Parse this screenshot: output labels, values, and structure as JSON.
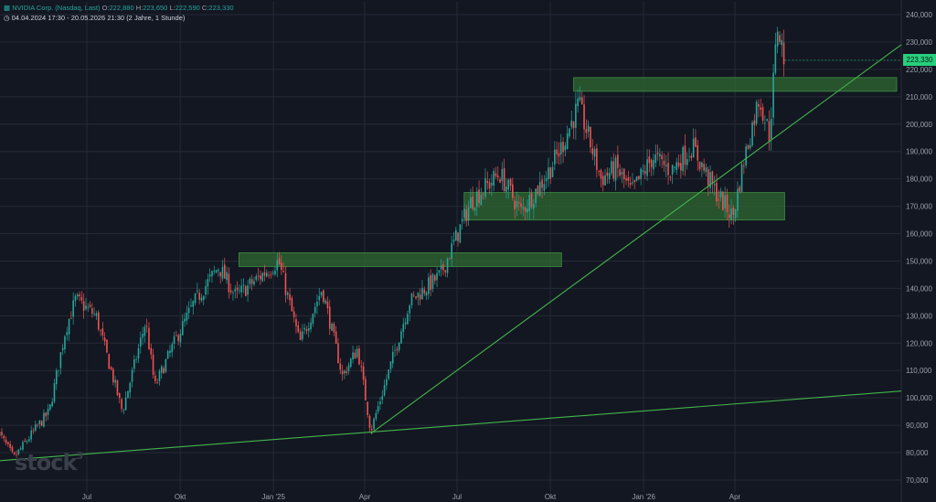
{
  "header": {
    "symbol": "NVIDIA Corp. (Nasdaq, Last)",
    "open_label": "O:",
    "open": "222,880",
    "high_label": "H:",
    "high": "223,650",
    "low_label": "L:",
    "low": "222,590",
    "close_label": "C:",
    "close": "223,330",
    "range": "04.04.2024 17:30 - 20.05.2026 21:30",
    "interval": "(2 Jahre, 1 Stunde)"
  },
  "logo": {
    "text": "stock",
    "mark": "3"
  },
  "colors": {
    "background": "#131722",
    "grid": "#252a36",
    "up": "#26a69a",
    "down": "#ef5350",
    "trendline": "#43b54a",
    "zone": "#2f6b32",
    "price_tag": "#26d07c",
    "axis_text": "#9aa0ad"
  },
  "chart_data": {
    "type": "candlestick",
    "title": "NVIDIA Corp. (Nasdaq, Last)",
    "x_range": [
      "2024-04-04",
      "2026-05-20"
    ],
    "ylim": [
      70000,
      240000
    ],
    "y_ticks": [
      {
        "value": 240000,
        "label": "240,000"
      },
      {
        "value": 230000,
        "label": "230,000"
      },
      {
        "value": 220000,
        "label": "220,000"
      },
      {
        "value": 210000,
        "label": "210,000"
      },
      {
        "value": 200000,
        "label": "200,000"
      },
      {
        "value": 190000,
        "label": "190,000"
      },
      {
        "value": 180000,
        "label": "180,000"
      },
      {
        "value": 170000,
        "label": "170,000"
      },
      {
        "value": 160000,
        "label": "160,000"
      },
      {
        "value": 150000,
        "label": "150,000"
      },
      {
        "value": 140000,
        "label": "140,000"
      },
      {
        "value": 130000,
        "label": "130,000"
      },
      {
        "value": 120000,
        "label": "120,000"
      },
      {
        "value": 110000,
        "label": "110,000"
      },
      {
        "value": 100000,
        "label": "100,000"
      },
      {
        "value": 90000,
        "label": "90,000"
      },
      {
        "value": 80000,
        "label": "80,000"
      },
      {
        "value": 70000,
        "label": "70,000"
      }
    ],
    "x_ticks": [
      {
        "date": "2024-07-01",
        "label": "Jul"
      },
      {
        "date": "2024-10-01",
        "label": "Okt"
      },
      {
        "date": "2025-01-01",
        "label": "Jan '25"
      },
      {
        "date": "2025-04-01",
        "label": "Apr"
      },
      {
        "date": "2025-07-01",
        "label": "Jul"
      },
      {
        "date": "2025-10-01",
        "label": "Okt"
      },
      {
        "date": "2026-01-01",
        "label": "Jan '26"
      },
      {
        "date": "2026-04-01",
        "label": "Apr"
      }
    ],
    "grid": true,
    "last_price": {
      "value": 223330,
      "label": "223,330"
    },
    "price_path": [
      {
        "date": "2024-04-04",
        "value": 88000
      },
      {
        "date": "2024-04-20",
        "value": 78000
      },
      {
        "date": "2024-05-10",
        "value": 88000
      },
      {
        "date": "2024-05-25",
        "value": 95000
      },
      {
        "date": "2024-06-10",
        "value": 125000
      },
      {
        "date": "2024-06-20",
        "value": 136000
      },
      {
        "date": "2024-07-10",
        "value": 130000
      },
      {
        "date": "2024-08-05",
        "value": 95000
      },
      {
        "date": "2024-08-28",
        "value": 128000
      },
      {
        "date": "2024-09-06",
        "value": 104000
      },
      {
        "date": "2024-09-25",
        "value": 120000
      },
      {
        "date": "2024-10-15",
        "value": 135000
      },
      {
        "date": "2024-11-08",
        "value": 148000
      },
      {
        "date": "2024-11-25",
        "value": 137000
      },
      {
        "date": "2025-01-06",
        "value": 150000
      },
      {
        "date": "2025-01-27",
        "value": 120000
      },
      {
        "date": "2025-02-18",
        "value": 140000
      },
      {
        "date": "2025-03-10",
        "value": 108000
      },
      {
        "date": "2025-03-25",
        "value": 118000
      },
      {
        "date": "2025-04-07",
        "value": 88000
      },
      {
        "date": "2025-04-25",
        "value": 110000
      },
      {
        "date": "2025-05-15",
        "value": 135000
      },
      {
        "date": "2025-06-15",
        "value": 145000
      },
      {
        "date": "2025-07-15",
        "value": 172000
      },
      {
        "date": "2025-08-12",
        "value": 182000
      },
      {
        "date": "2025-09-02",
        "value": 168000
      },
      {
        "date": "2025-09-25",
        "value": 180000
      },
      {
        "date": "2025-10-10",
        "value": 190000
      },
      {
        "date": "2025-10-29",
        "value": 207000
      },
      {
        "date": "2025-11-20",
        "value": 180000
      },
      {
        "date": "2025-12-05",
        "value": 184000
      },
      {
        "date": "2025-12-20",
        "value": 175000
      },
      {
        "date": "2026-01-10",
        "value": 188000
      },
      {
        "date": "2026-01-28",
        "value": 183000
      },
      {
        "date": "2026-02-18",
        "value": 192000
      },
      {
        "date": "2026-03-10",
        "value": 177000
      },
      {
        "date": "2026-03-30",
        "value": 166000
      },
      {
        "date": "2026-04-10",
        "value": 187000
      },
      {
        "date": "2026-04-25",
        "value": 210000
      },
      {
        "date": "2026-05-05",
        "value": 196000
      },
      {
        "date": "2026-05-13",
        "value": 236000
      },
      {
        "date": "2026-05-20",
        "value": 223330
      }
    ],
    "trendlines": [
      {
        "from": {
          "date": "2024-04-04",
          "value": 77000
        },
        "to": {
          "date": "2026-09-15",
          "value": 102500
        }
      },
      {
        "from": {
          "date": "2025-04-07",
          "value": 87000
        },
        "to": {
          "date": "2026-09-15",
          "value": 229000
        }
      }
    ],
    "zones": [
      {
        "from_date": "2024-11-28",
        "to_date": "2025-10-12",
        "low": 148000,
        "high": 153000
      },
      {
        "from_date": "2025-07-08",
        "to_date": "2026-05-20",
        "low": 165000,
        "high": 175000
      },
      {
        "from_date": "2025-10-24",
        "to_date": "2026-09-10",
        "low": 212000,
        "high": 217000
      }
    ]
  }
}
